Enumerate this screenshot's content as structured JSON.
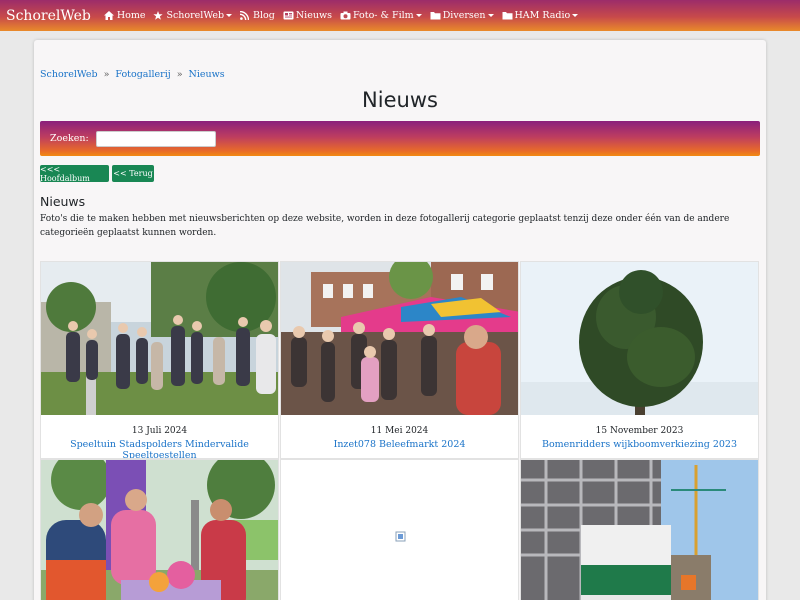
{
  "navbar": {
    "brand": "SchorelWeb",
    "items": [
      {
        "label": "Home",
        "icon": "home-icon",
        "dropdown": false
      },
      {
        "label": "SchorelWeb",
        "icon": "star-icon",
        "dropdown": true
      },
      {
        "label": "Blog",
        "icon": "rss-icon",
        "dropdown": false
      },
      {
        "label": "Nieuws",
        "icon": "newspaper-icon",
        "dropdown": false
      },
      {
        "label": "Foto- & Film",
        "icon": "camera-icon",
        "dropdown": true
      },
      {
        "label": "Diversen",
        "icon": "folder-icon",
        "dropdown": true
      },
      {
        "label": "HAM Radio",
        "icon": "folder-icon",
        "dropdown": true
      }
    ]
  },
  "breadcrumb": [
    "SchorelWeb",
    "Fotogallerij",
    "Nieuws"
  ],
  "breadcrumb_separator": "»",
  "page_title": "Nieuws",
  "search": {
    "label": "Zoeken:",
    "value": ""
  },
  "buttons": {
    "main_album": "<<< Hoofdalbum",
    "back": "<< Terug"
  },
  "section": {
    "heading": "Nieuws",
    "description": "Foto's die te maken hebben met nieuwsberichten op deze website, worden in deze fotogallerij categorie geplaatst tenzij deze onder één van de andere categorieën geplaatst kunnen worden."
  },
  "cards": [
    {
      "date": "13 Juli 2024",
      "title": "Speeltuin Stadspolders Mindervalide Speeltoestellen"
    },
    {
      "date": "11 Mei 2024",
      "title": "Inzet078 Beleefmarkt 2024"
    },
    {
      "date": "15 November 2023",
      "title": "Bomenridders wijkboomverkiezing 2023"
    },
    {
      "date": "",
      "title": ""
    },
    {
      "date": "",
      "title": ""
    },
    {
      "date": "",
      "title": ""
    }
  ],
  "colors": {
    "accent_link": "#1a73c8",
    "button_green": "#198754",
    "nav_gradient_top": "#9c2c6a",
    "nav_gradient_bottom": "#e98a2a"
  }
}
